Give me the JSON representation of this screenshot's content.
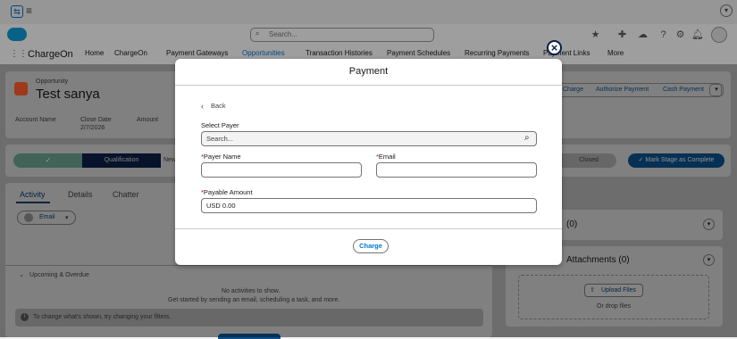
{
  "app": {
    "name": "ChargeOn",
    "search_placeholder": "Search..."
  },
  "nav": {
    "items": [
      "Home",
      "ChargeOn",
      "Payment Gateways",
      "Opportunities",
      "Transaction Histories",
      "Payment Schedules",
      "Recurring Payments",
      "Payment Links",
      "More"
    ]
  },
  "record": {
    "type": "Opportunity",
    "name": "Test sanya",
    "fields": [
      {
        "label": "Account Name",
        "value": ""
      },
      {
        "label": "Close Date",
        "value": "2/7/2026"
      },
      {
        "label": "Amount",
        "value": ""
      }
    ],
    "actions": [
      "Charge",
      "Authorize Payment",
      "Cash Payment"
    ]
  },
  "path": {
    "stages": [
      "Qualification",
      "New",
      "Closed"
    ],
    "mark_complete_label": "Mark Stage as Complete"
  },
  "tabs": [
    "Activity",
    "Details",
    "Chatter"
  ],
  "activity": {
    "email_label": "Email",
    "upcoming_label": "Upcoming & Overdue",
    "empty_title": "No activities to show.",
    "empty_sub": "Get started by sending an email, scheduling a task, and more.",
    "filter_hint": "To change what's shown, try changing your filters."
  },
  "side": {
    "related_count": "(0)",
    "attachments_title": "Attachments (0)",
    "upload_label": "Upload Files",
    "drop_label": "Or drop files"
  },
  "modal": {
    "title": "Payment",
    "back_label": "Back",
    "select_payer_label": "Select Payer",
    "search_placeholder": "Search...",
    "payer_name_label": "Payer Name",
    "email_label": "Email",
    "payable_amount_label": "Payable Amount",
    "payable_amount_value": "USD 0.00",
    "charge_label": "Charge",
    "required_marker": "*"
  }
}
